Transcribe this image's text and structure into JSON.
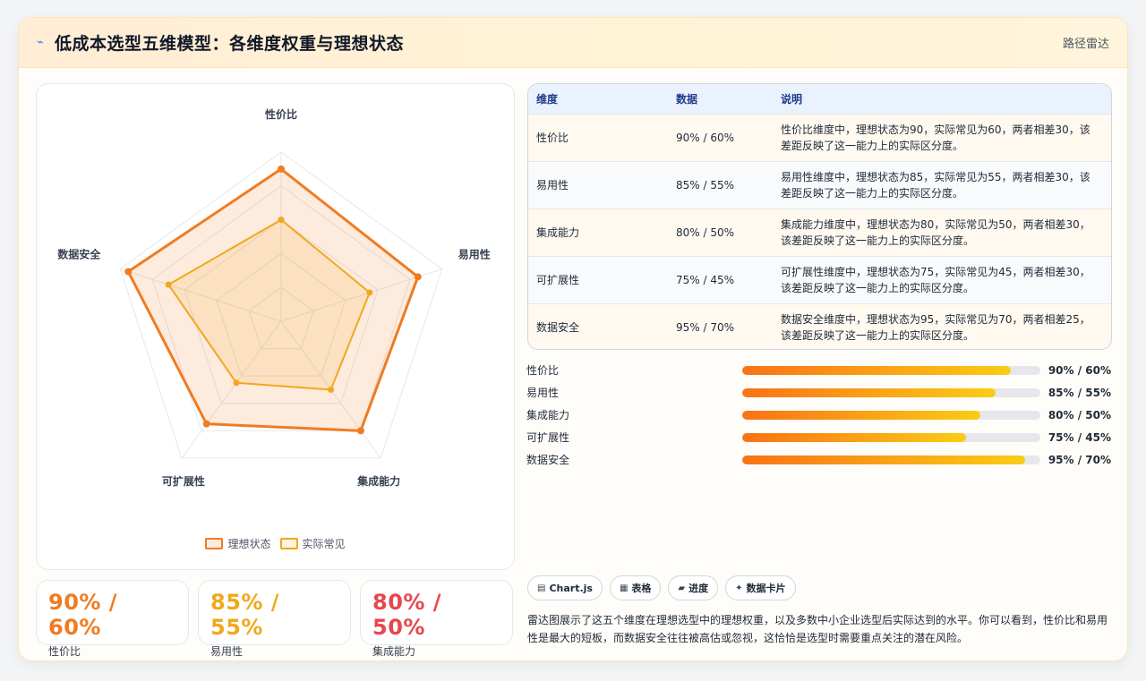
{
  "header": {
    "title": "低成本选型五维模型：各维度权重与理想状态",
    "nav_link": "路径雷达",
    "icon": "bolt-icon"
  },
  "colors": {
    "ideal": "#f07b22",
    "actual": "#f1a81c",
    "stat_orange": "#f07b22",
    "stat_amber": "#f1a81c",
    "stat_red": "#e5484d"
  },
  "chart_data": {
    "type": "radar",
    "categories": [
      "性价比",
      "易用性",
      "集成能力",
      "可扩展性",
      "数据安全"
    ],
    "series": [
      {
        "name": "理想状态",
        "values": [
          90,
          85,
          80,
          75,
          95
        ]
      },
      {
        "name": "实际常见",
        "values": [
          60,
          55,
          50,
          45,
          70
        ]
      }
    ],
    "rlim": [
      0,
      100
    ],
    "legend_position": "bottom"
  },
  "legend": {
    "ideal": "理想状态",
    "actual": "实际常见"
  },
  "stats": [
    {
      "value": "90% / 60%",
      "label": "性价比"
    },
    {
      "value": "85% / 55%",
      "label": "易用性"
    },
    {
      "value": "80% / 50%",
      "label": "集成能力"
    }
  ],
  "table": {
    "headers": [
      "维度",
      "数据",
      "说明"
    ],
    "rows": [
      {
        "dim": "性价比",
        "data": "90% / 60%",
        "desc": "性价比维度中，理想状态为90，实际常见为60，两者相差30，该差距反映了这一能力上的实际区分度。"
      },
      {
        "dim": "易用性",
        "data": "85% / 55%",
        "desc": "易用性维度中，理想状态为85，实际常见为55，两者相差30，该差距反映了这一能力上的实际区分度。"
      },
      {
        "dim": "集成能力",
        "data": "80% / 50%",
        "desc": "集成能力维度中，理想状态为80，实际常见为50，两者相差30，该差距反映了这一能力上的实际区分度。"
      },
      {
        "dim": "可扩展性",
        "data": "75% / 45%",
        "desc": "可扩展性维度中，理想状态为75，实际常见为45，两者相差30，该差距反映了这一能力上的实际区分度。"
      },
      {
        "dim": "数据安全",
        "data": "95% / 70%",
        "desc": "数据安全维度中，理想状态为95，实际常见为70，两者相差25，该差距反映了这一能力上的实际区分度。"
      }
    ]
  },
  "bars": [
    {
      "label": "性价比",
      "value": "90% / 60%",
      "fill": 0.9
    },
    {
      "label": "易用性",
      "value": "85% / 55%",
      "fill": 0.85
    },
    {
      "label": "集成能力",
      "value": "80% / 50%",
      "fill": 0.8
    },
    {
      "label": "可扩展性",
      "value": "75% / 45%",
      "fill": 0.75
    },
    {
      "label": "数据安全",
      "value": "95% / 70%",
      "fill": 0.95
    }
  ],
  "chips": [
    {
      "icon": "chart-icon",
      "glyph": "▤",
      "label": "Chart.js"
    },
    {
      "icon": "table-icon",
      "glyph": "▦",
      "label": "表格"
    },
    {
      "icon": "progress-icon",
      "glyph": "▰",
      "label": "进度"
    },
    {
      "icon": "card-icon",
      "glyph": "✦",
      "label": "数据卡片"
    }
  ],
  "note": "雷达图展示了这五个维度在理想选型中的理想权重，以及多数中小企业选型后实际达到的水平。你可以看到，性价比和易用性是最大的短板，而数据安全往往被高估或忽视，这恰恰是选型时需要重点关注的潜在风险。"
}
